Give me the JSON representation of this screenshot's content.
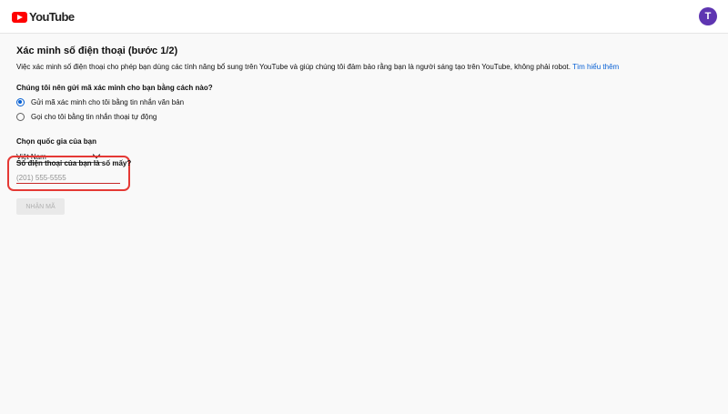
{
  "header": {
    "logo_text": "YouTube",
    "avatar_initial": "T"
  },
  "verify": {
    "title": "Xác minh số điện thoại (bước 1/2)",
    "description": "Việc xác minh số điện thoại cho phép bạn dùng các tính năng bổ sung trên YouTube và giúp chúng tôi đảm bảo rằng bạn là người sáng tạo trên YouTube, không phải robot.",
    "learn_more": "Tìm hiểu thêm",
    "question": "Chúng tôi nên gửi mã xác minh cho bạn bằng cách nào?",
    "options": [
      {
        "label": "Gửi mã xác minh cho tôi bằng tin nhắn văn bản",
        "selected": true
      },
      {
        "label": "Gọi cho tôi bằng tin nhắn thoại tự động",
        "selected": false
      }
    ],
    "country_label": "Chọn quốc gia của bạn",
    "country_value": "Việt Nam",
    "phone_label": "Số điện thoại của bạn là số mấy?",
    "phone_placeholder": "(201) 555-5555",
    "phone_value": "",
    "submit_label": "NHẬN MÃ",
    "submit_disabled": true
  },
  "colors": {
    "brand_red": "#ff0000",
    "link_blue": "#065fd4",
    "avatar_purple": "#5e35b1",
    "highlight_red": "#e53935"
  },
  "icons": [
    "youtube-logo-icon",
    "chevron-down-icon"
  ]
}
